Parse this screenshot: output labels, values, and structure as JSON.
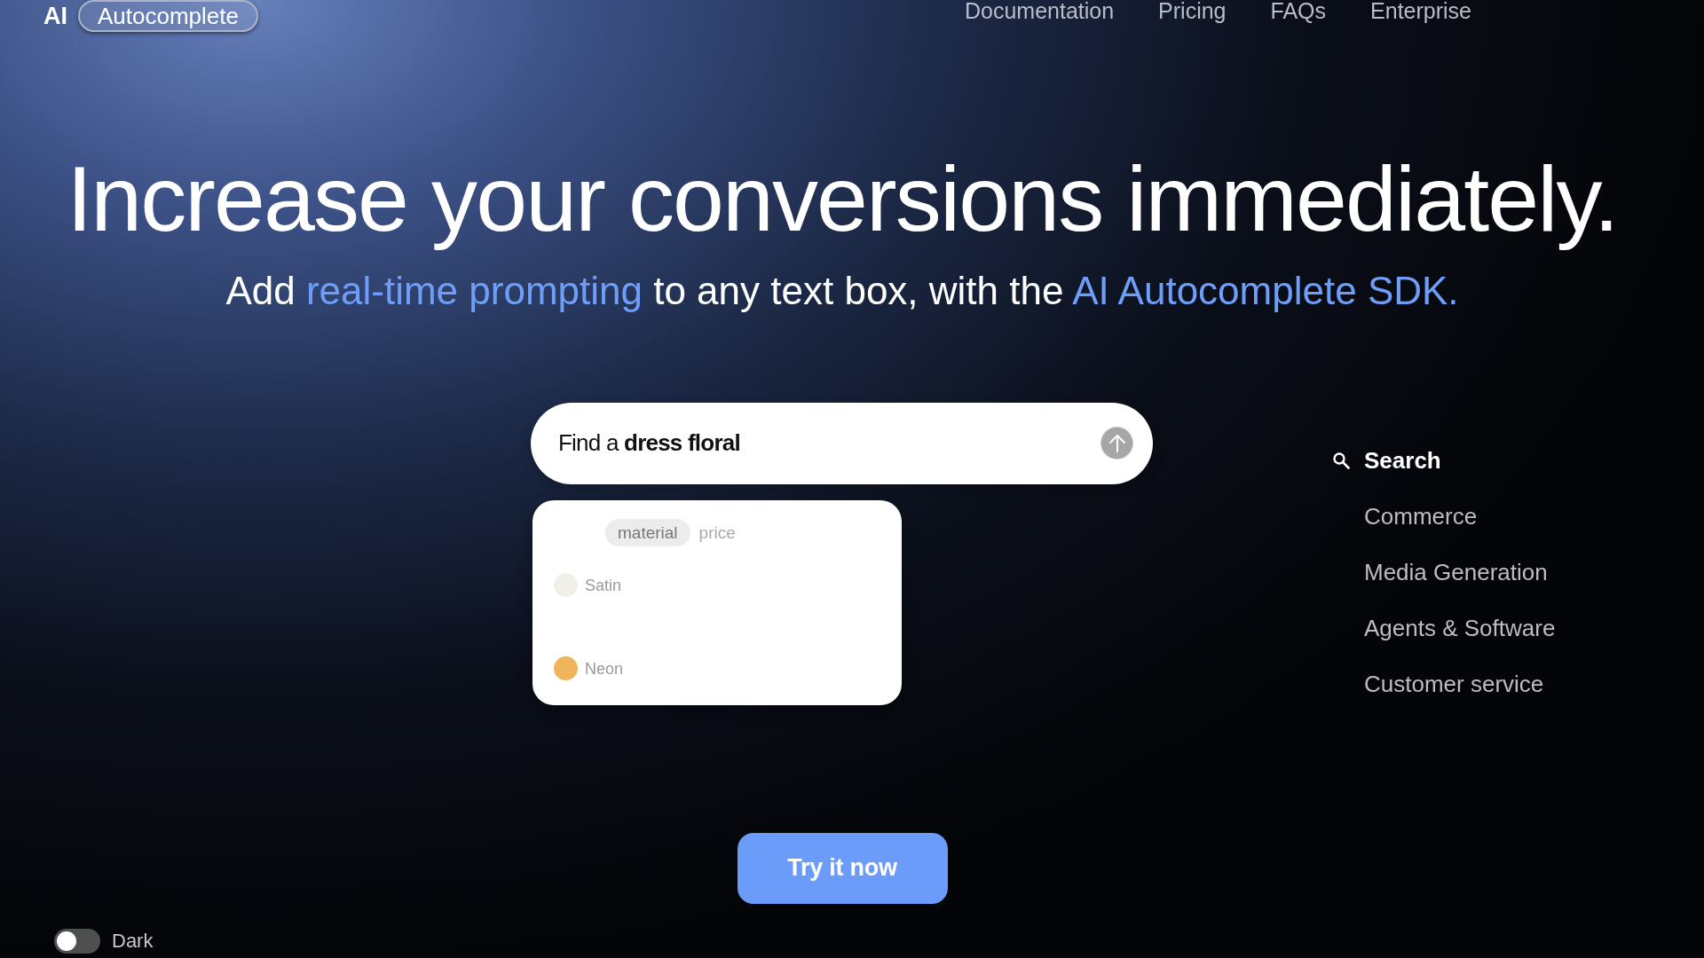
{
  "header": {
    "logo": {
      "prefix": "AI",
      "badge": "Autocomplete"
    },
    "nav": [
      "Documentation",
      "Pricing",
      "FAQs",
      "Enterprise"
    ]
  },
  "hero": {
    "title": "Increase your conversions immediately.",
    "subtitle": [
      {
        "text": "Add ",
        "highlight": false
      },
      {
        "text": "real-time prompting",
        "highlight": true
      },
      {
        "text": " to any text box, with the ",
        "highlight": false
      },
      {
        "text": "AI Autocomplete SDK.",
        "highlight": true
      }
    ]
  },
  "demo": {
    "search": {
      "value": "Find a **dress floral**"
    },
    "suggestions": {
      "chips": [
        {
          "label": "material",
          "selected": true
        },
        {
          "label": "price",
          "selected": false
        }
      ],
      "rows": [
        {
          "label": "Satin",
          "color": "#f1f0e8"
        },
        {
          "label": "Neon",
          "color": "#f0b45c"
        }
      ]
    }
  },
  "use_cases": [
    {
      "label": "Search",
      "selected": true
    },
    {
      "label": "Commerce",
      "selected": false
    },
    {
      "label": "Media Generation",
      "selected": false
    },
    {
      "label": "Agents & Software",
      "selected": false
    },
    {
      "label": "Customer service",
      "selected": false
    }
  ],
  "cta": "Try it now",
  "theme_toggle": {
    "label": "Dark",
    "on": false
  }
}
